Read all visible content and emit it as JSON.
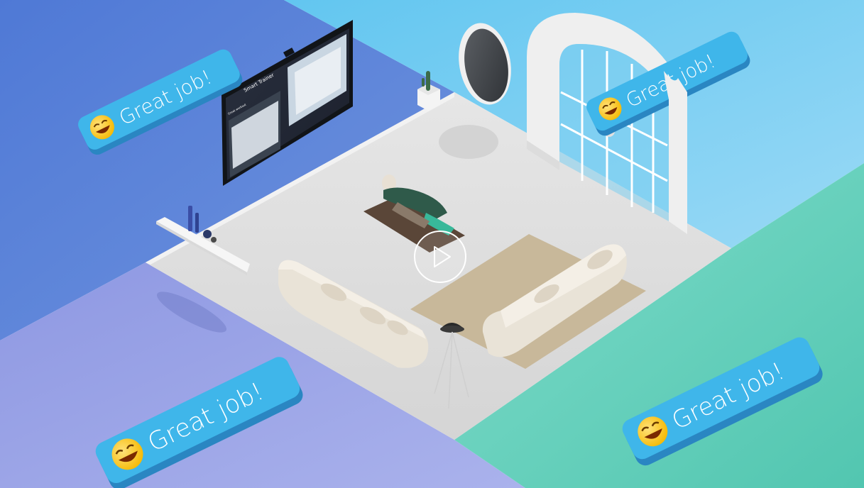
{
  "video": {
    "play_button_icon": "play-icon",
    "play_button_label": "Play video"
  },
  "tv_screen": {
    "header_title": "Smart Trainer",
    "small_text": "Great workout"
  },
  "badges": [
    {
      "text": "Great job!",
      "emoji_icon": "laughing-emoji-icon"
    },
    {
      "text": "Great job!",
      "emoji_icon": "laughing-emoji-icon"
    },
    {
      "text": "Great job!",
      "emoji_icon": "laughing-emoji-icon"
    },
    {
      "text": "Great job!",
      "emoji_icon": "laughing-emoji-icon"
    }
  ],
  "colors": {
    "top_left_panel": "#5b86d8",
    "top_right_panel": "#7ecdf0",
    "bottom_left_panel": "#9aa6e6",
    "bottom_right_panel": "#6fd3c0",
    "floor": "#dcdcdc",
    "badge_fill": "#3fb6ea",
    "badge_side": "#2a86c2"
  }
}
